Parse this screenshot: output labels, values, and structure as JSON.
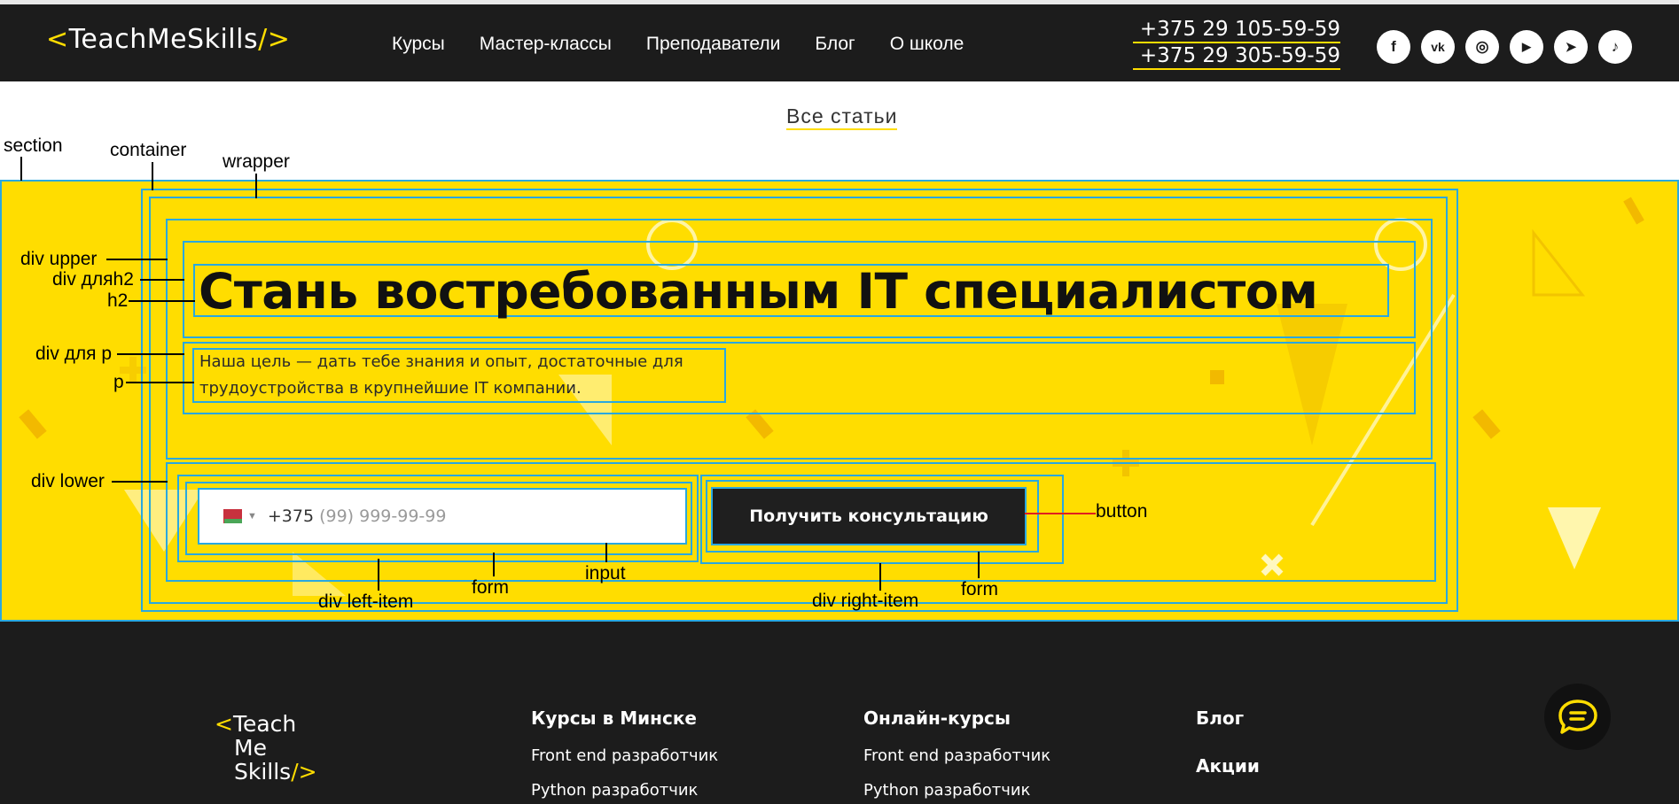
{
  "header": {
    "logo": {
      "left_bracket": "<",
      "name": "TeachMeSkills",
      "right_bracket": "/>"
    },
    "nav": [
      "Курсы",
      "Мастер-классы",
      "Преподаватели",
      "Блог",
      "О школе"
    ],
    "phones": [
      "+375 29 105-59-59",
      "+375 29 305-59-59"
    ],
    "socials": [
      {
        "icon": "facebook-icon",
        "glyph": "f"
      },
      {
        "icon": "vk-icon",
        "glyph": "vk"
      },
      {
        "icon": "instagram-icon",
        "glyph": "◎"
      },
      {
        "icon": "youtube-icon",
        "glyph": "▶"
      },
      {
        "icon": "telegram-icon",
        "glyph": "➤"
      },
      {
        "icon": "tiktok-icon",
        "glyph": "♪"
      }
    ]
  },
  "all_articles": "Все статьи",
  "annotations": {
    "section": "section",
    "container": "container",
    "wrapper": "wrapper",
    "div_upper": "div upper",
    "div_h2": "div дляh2",
    "h2": "h2",
    "div_p": "div для p",
    "p": "p",
    "div_lower": "div lower",
    "div_left_item": "div left-item",
    "form_left": "form",
    "input": "input",
    "div_right_item": "div right-item",
    "form_right": "form",
    "button": "button"
  },
  "promo": {
    "title": "Стань востребованным IT специалистом",
    "paragraph": "Наша цель — дать тебе знания и опыт, достаточные для трудоустройства в крупнейшие IT компании.",
    "phone_prefix": "+375",
    "phone_placeholder": "(99) 999-99-99",
    "button": "Получить консультацию"
  },
  "footer": {
    "logo": {
      "line1": "Teach",
      "line2": "Me",
      "line3": "Skills"
    },
    "columns": [
      {
        "title": "Курсы в Минске",
        "links": [
          "Front end разработчик",
          "Python разработчик"
        ]
      },
      {
        "title": "Онлайн-курсы",
        "links": [
          "Front end разработчик",
          "Python разработчик"
        ]
      },
      {
        "title": "Блог",
        "links": []
      },
      {
        "title": "Акции",
        "links": []
      }
    ]
  },
  "colors": {
    "brand_yellow": "#ffdd00",
    "dark": "#1c1c1c",
    "annotation_blue": "#29a8e0",
    "annotation_red": "#e02020"
  }
}
